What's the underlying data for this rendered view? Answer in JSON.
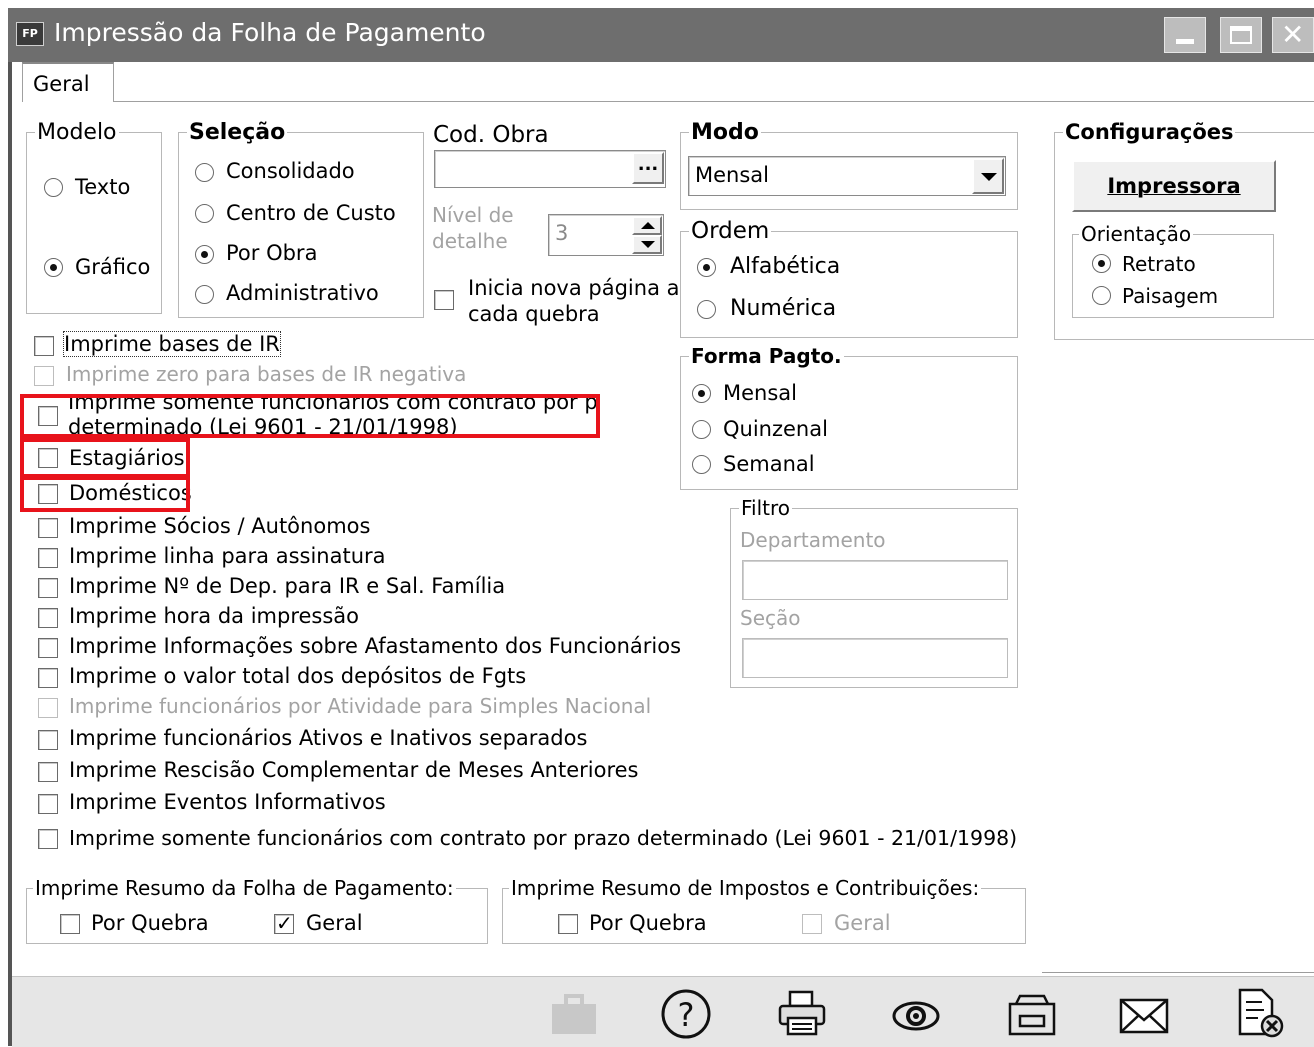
{
  "window": {
    "icon_text": "FP",
    "title": "Impressão da Folha de Pagamento"
  },
  "tabs": [
    {
      "label": "Geral"
    }
  ],
  "modelo": {
    "legend": "Modelo",
    "options": [
      {
        "label": "Texto",
        "selected": false
      },
      {
        "label": "Gráfico",
        "selected": true
      }
    ]
  },
  "selecao": {
    "legend": "Seleção",
    "options": [
      {
        "label": "Consolidado",
        "selected": false
      },
      {
        "label": "Centro de Custo",
        "selected": false
      },
      {
        "label": "Por Obra",
        "selected": true
      },
      {
        "label": "Administrativo",
        "selected": false
      }
    ]
  },
  "cod_obra": {
    "label": "Cod. Obra",
    "value": "",
    "browse_button": "...",
    "nivel_label_1": "Nível de",
    "nivel_label_2": "detalhe",
    "nivel_value": "3",
    "nova_pagina_label_1": "Inicia nova página a",
    "nova_pagina_label_2": "cada quebra"
  },
  "modo": {
    "legend": "Modo",
    "value": "Mensal"
  },
  "ordem": {
    "legend": "Ordem",
    "options": [
      {
        "label": "Alfabética",
        "selected": true
      },
      {
        "label": "Numérica",
        "selected": false
      }
    ]
  },
  "forma_pagto": {
    "legend": "Forma Pagto.",
    "options": [
      {
        "label": "Mensal",
        "selected": true
      },
      {
        "label": "Quinzenal",
        "selected": false
      },
      {
        "label": "Semanal",
        "selected": false
      }
    ]
  },
  "filtro": {
    "legend": "Filtro",
    "departamento_label": "Departamento",
    "departamento_value": "",
    "secao_label": "Seção",
    "secao_value": ""
  },
  "configuracoes": {
    "legend": "Configurações",
    "impressora_button": "Impressora",
    "orientacao_legend": "Orientação",
    "orientacao_options": [
      {
        "label": "Retrato",
        "selected": true
      },
      {
        "label": "Paisagem",
        "selected": false
      }
    ]
  },
  "checks": [
    {
      "label": "Imprime bases de IR",
      "checked": false,
      "enabled": true
    },
    {
      "label": "Imprime zero para bases de IR negativa",
      "checked": false,
      "enabled": false
    },
    {
      "label": "Imprime somente funcionários com contrato por prazo",
      "label2": "determinado (Lei 9601 - 21/01/1998)",
      "checked": false,
      "enabled": true
    },
    {
      "label": "Estagiários",
      "checked": false,
      "enabled": true
    },
    {
      "label": "Domésticos",
      "checked": false,
      "enabled": true
    },
    {
      "label": "Imprime Sócios / Autônomos",
      "checked": false,
      "enabled": true
    },
    {
      "label": "Imprime linha para assinatura",
      "checked": false,
      "enabled": true
    },
    {
      "label": "Imprime Nº de Dep. para IR e Sal. Família",
      "checked": false,
      "enabled": true
    },
    {
      "label": "Imprime hora da impressão",
      "checked": false,
      "enabled": true
    },
    {
      "label": "Imprime Informações sobre Afastamento dos Funcionários",
      "checked": false,
      "enabled": true
    },
    {
      "label": "Imprime o valor total dos depósitos de Fgts",
      "checked": false,
      "enabled": true
    },
    {
      "label": "Imprime funcionários por Atividade para Simples Nacional",
      "checked": false,
      "enabled": false
    },
    {
      "label": "Imprime funcionários Ativos e Inativos separados",
      "checked": false,
      "enabled": true
    },
    {
      "label": "Imprime Rescisão Complementar de Meses Anteriores",
      "checked": false,
      "enabled": true
    },
    {
      "label": "Imprime Eventos Informativos",
      "checked": false,
      "enabled": true
    },
    {
      "label": "Imprime somente funcionários com contrato por prazo determinado (Lei 9601 - 21/01/1998)",
      "checked": false,
      "enabled": true
    }
  ],
  "resumo_folha": {
    "legend": "Imprime Resumo da Folha de Pagamento:",
    "por_quebra": "Por Quebra",
    "por_quebra_checked": false,
    "geral": "Geral",
    "geral_checked": true
  },
  "resumo_impostos": {
    "legend": "Imprime Resumo de Impostos e Contribuições:",
    "por_quebra": "Por Quebra",
    "por_quebra_checked": false,
    "geral": "Geral",
    "geral_checked": false
  },
  "toolbar_icons": [
    "briefcase-icon",
    "help-icon",
    "printer-icon",
    "preview-eye-icon",
    "export-icon",
    "email-icon",
    "close-document-icon"
  ],
  "colors": {
    "titlebar": "#6e6e6e",
    "highlight": "#e8131b",
    "footer": "#e6e6e6"
  }
}
